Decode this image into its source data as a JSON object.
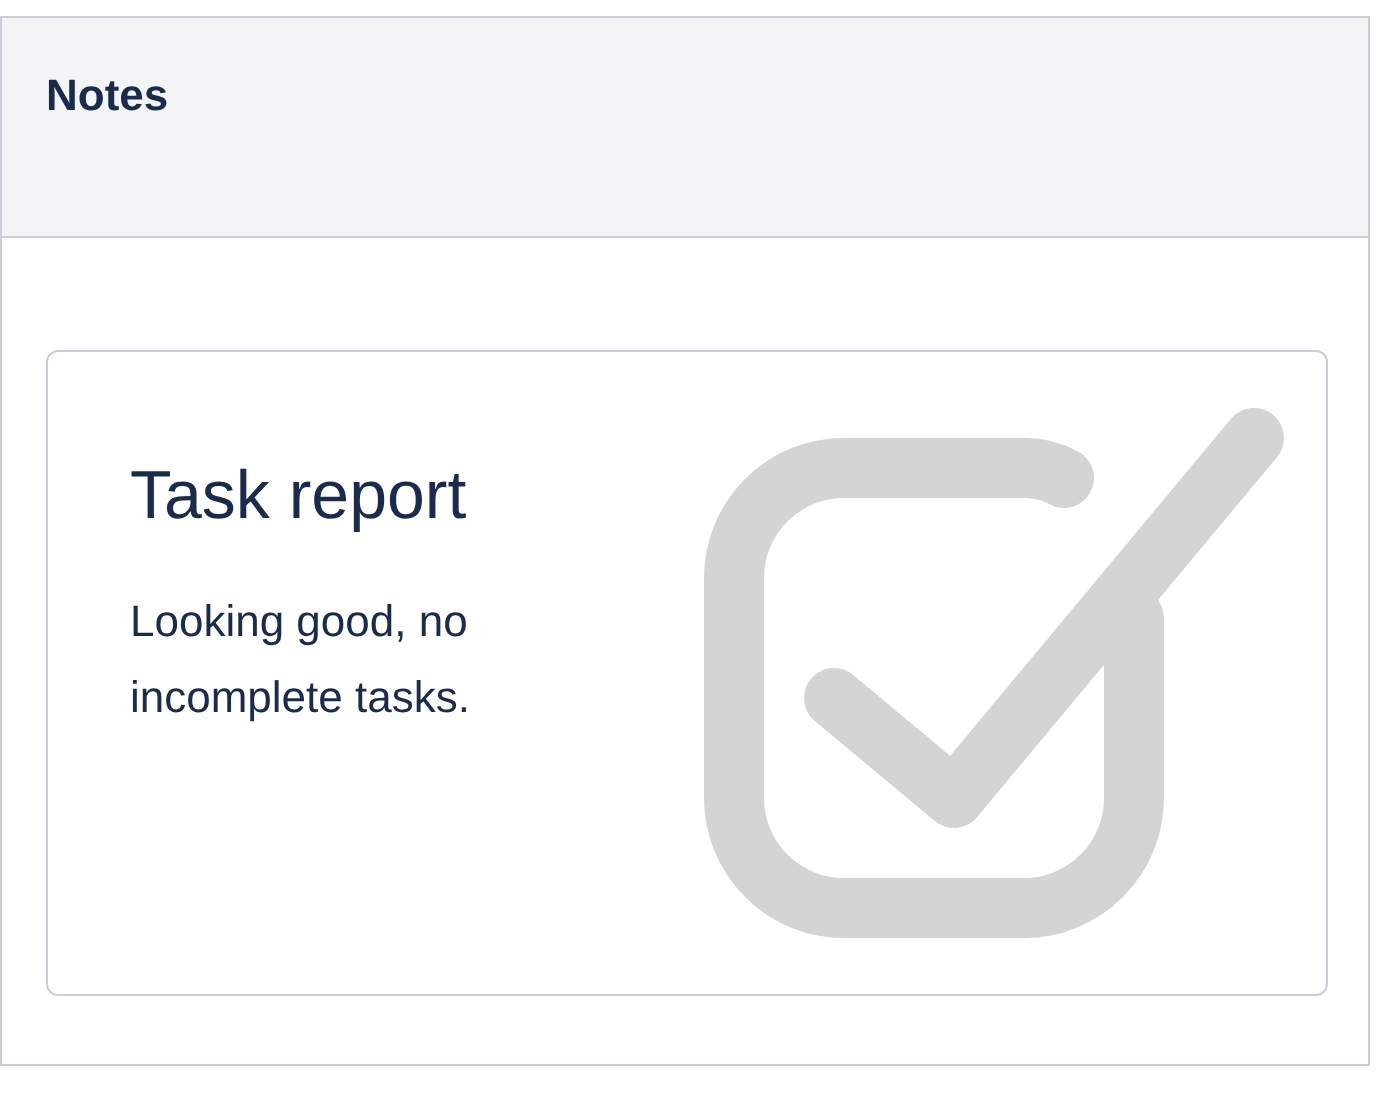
{
  "panel": {
    "title": "Notes"
  },
  "card": {
    "title": "Task report",
    "text": "Looking good, no incomplete tasks."
  }
}
